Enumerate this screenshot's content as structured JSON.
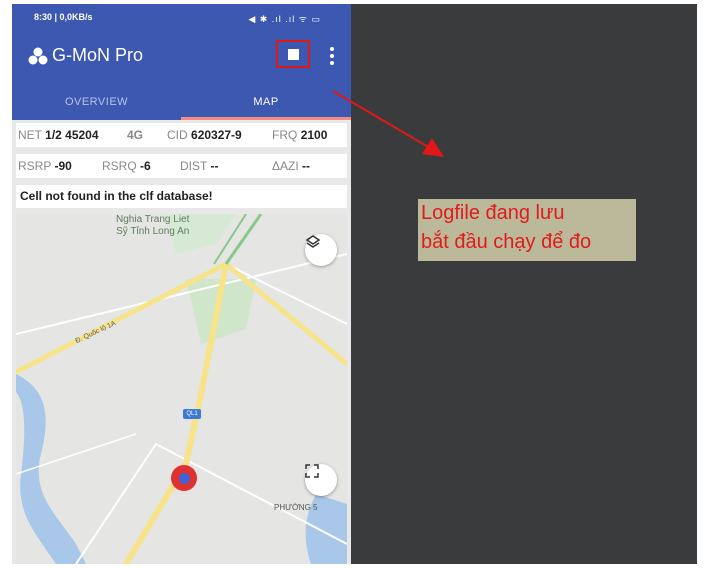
{
  "status_bar": {
    "left": "8:30 | 0,0KB/s",
    "right": "◀ ✱ .ıl .ıl ᯤ ▭"
  },
  "app": {
    "title": "G-MoN Pro"
  },
  "tabs": [
    {
      "label": "OVERVIEW",
      "active": false
    },
    {
      "label": "MAP",
      "active": true
    }
  ],
  "info": {
    "net_label": "NET",
    "net_value": "1/2 45204",
    "tech": "4G",
    "cid_label": "CID",
    "cid_value": "620327-9",
    "frq_label": "FRQ",
    "frq_value": "2100",
    "rsrp_label": "RSRP",
    "rsrp_value": "-90",
    "rsrq_label": "RSRQ",
    "rsrq_value": "-6",
    "dist_label": "DIST",
    "dist_value": "--",
    "azi_label": "ΔAZI",
    "azi_value": "--",
    "message": "Cell not found in the clf database!"
  },
  "map": {
    "cemetery_label_1": "Nghia Trang Liet",
    "cemetery_label_2": "Sỹ Tỉnh Long An",
    "road_label": "Đ. Quốc lộ 1A",
    "ql_badge": "QL1",
    "phuong": "PHƯỜNG 5",
    "layers_icon": "layers-icon",
    "fullscreen_icon": "fullscreen-icon"
  },
  "annotation": {
    "line1": "Logfile đang lưu",
    "line2": "bắt đầu chạy để đo",
    "color": "#e01b1b"
  },
  "colors": {
    "app_bar": "#3d58b0",
    "highlight": "#e01818",
    "dark_panel": "#3a3b3d"
  }
}
